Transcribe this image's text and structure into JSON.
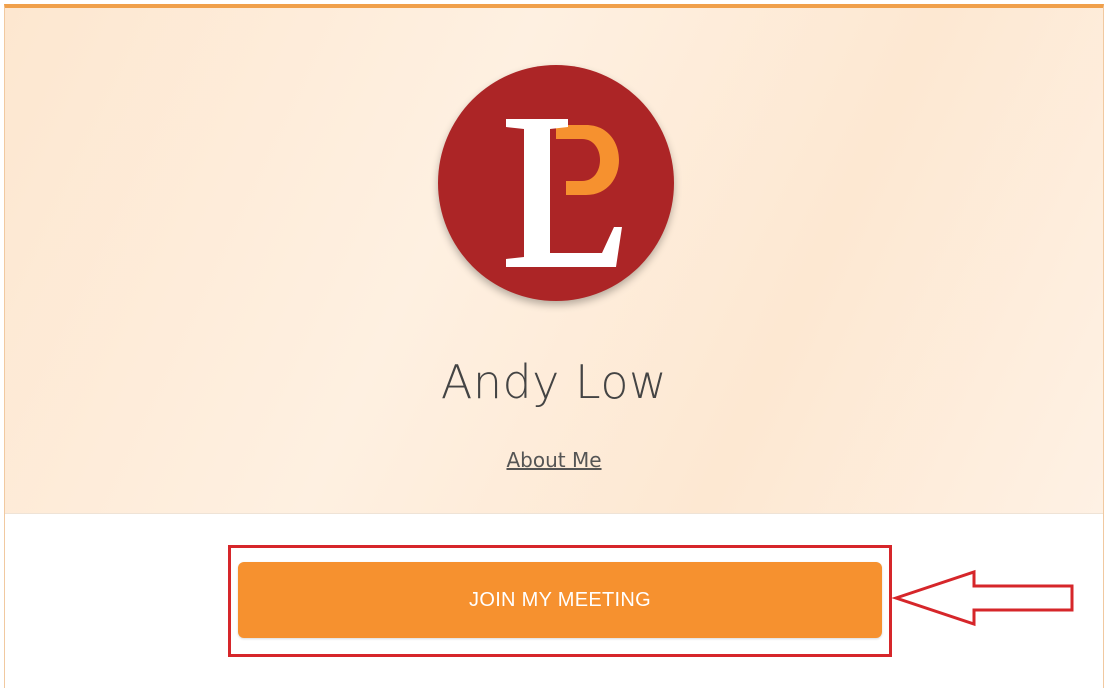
{
  "profile": {
    "name": "Andy Low",
    "about_link": "About Me",
    "logo_icon": "lp-monogram-logo",
    "logo_colors": {
      "circle": "#ac2526",
      "letter_l": "#ffffff",
      "letter_p": "#f6912f"
    }
  },
  "actions": {
    "join_label": "JOIN MY MEETING",
    "join_color": "#f6912f"
  },
  "annotation": {
    "box_color": "#d6262a",
    "arrow_icon": "left-arrow-outline-icon"
  }
}
